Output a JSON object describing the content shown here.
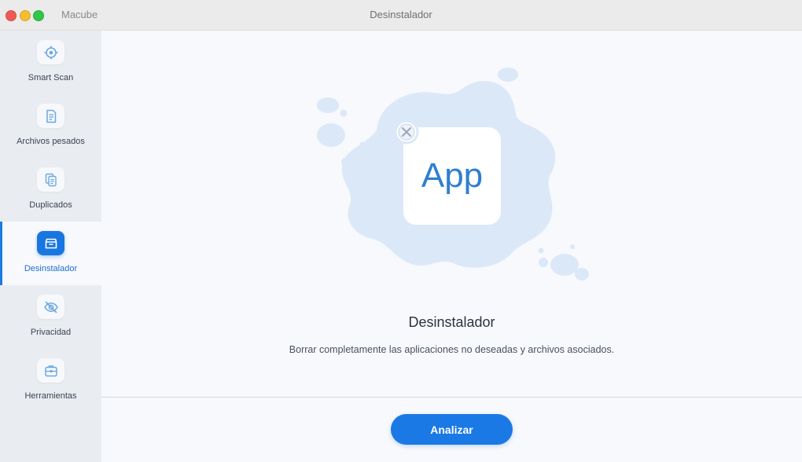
{
  "window": {
    "app_name": "Macube",
    "title": "Desinstalador"
  },
  "sidebar": {
    "items": [
      {
        "label": "Smart Scan",
        "icon": "target-icon",
        "active": false
      },
      {
        "label": "Archivos pesados",
        "icon": "file-icon",
        "active": false
      },
      {
        "label": "Duplicados",
        "icon": "copy-icon",
        "active": false
      },
      {
        "label": "Desinstalador",
        "icon": "archive-box-icon",
        "active": true
      },
      {
        "label": "Privacidad",
        "icon": "eye-off-icon",
        "active": false
      },
      {
        "label": "Herramientas",
        "icon": "toolbox-icon",
        "active": false
      }
    ]
  },
  "main": {
    "illustration_text": "App",
    "heading": "Desinstalador",
    "description": "Borrar completamente las aplicaciones no deseadas y archivos asociados.",
    "analyze_label": "Analizar"
  },
  "colors": {
    "accent": "#1a79e5",
    "sidebar_bg": "#e9ecf1",
    "main_bg": "#f8f9fc",
    "illustration_blob": "#dbe8f8",
    "app_text": "#2f7fd0"
  }
}
